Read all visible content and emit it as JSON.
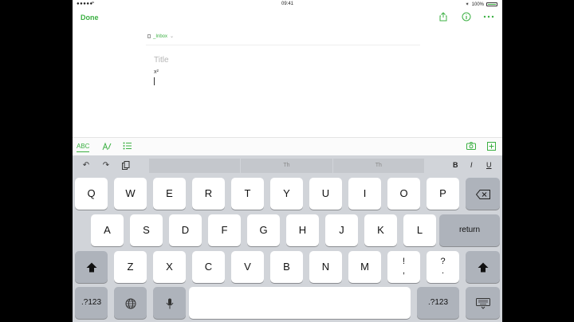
{
  "status": {
    "carrier": "●●●●●",
    "time": "09:41",
    "battery": "100%"
  },
  "nav": {
    "done_label": "Done"
  },
  "note": {
    "notebook": "_Inbox",
    "title_placeholder": "Title",
    "body_text": "x²"
  },
  "format_bar": {
    "abc_label": "ABC"
  },
  "keyboard": {
    "suggestions": [
      "",
      "Th",
      "Th"
    ],
    "bold": "B",
    "italic": "I",
    "underline": "U",
    "row1": [
      "Q",
      "W",
      "E",
      "R",
      "T",
      "Y",
      "U",
      "I",
      "O",
      "P"
    ],
    "row2": [
      "A",
      "S",
      "D",
      "F",
      "G",
      "H",
      "J",
      "K",
      "L"
    ],
    "row2_return": "return",
    "row3": [
      "Z",
      "X",
      "C",
      "V",
      "B",
      "N",
      "M"
    ],
    "row3_excl": [
      "!",
      ","
    ],
    "row3_quest": [
      "?",
      "."
    ],
    "numbers_label": ".?123",
    "numbers_label_right": ".?123"
  },
  "colors": {
    "accent": "#3cb043",
    "keyboard_bg": "#d1d4d9",
    "special_key": "#aeb3bb"
  }
}
